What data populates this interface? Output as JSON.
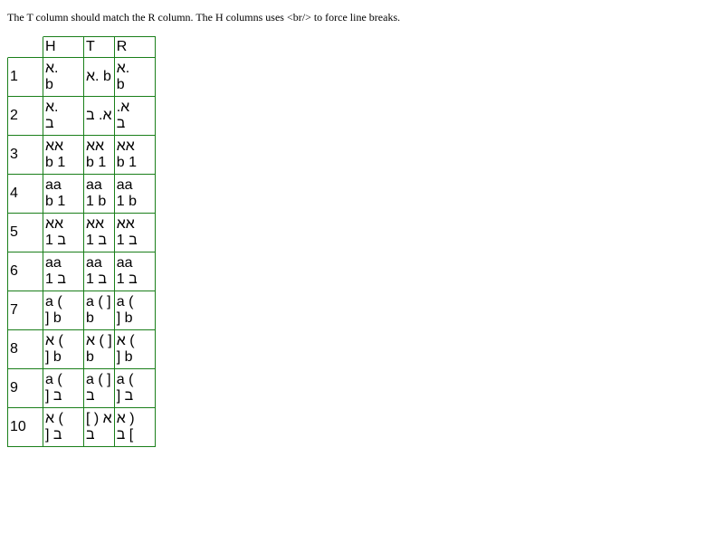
{
  "intro": "The T column should match the R column. The H columns uses <br/> to force line breaks.",
  "headers": {
    "blank": "",
    "h": "H",
    "t": "T",
    "r": "R"
  },
  "rows": [
    {
      "n": "1",
      "h": [
        "א.",
        "b"
      ],
      "t": [
        "א. b"
      ],
      "r": [
        "א.",
        "b"
      ]
    },
    {
      "n": "2",
      "h": [
        "א.",
        "ב"
      ],
      "t": [
        "א. ב"
      ],
      "r": [
        ".א",
        "ב"
      ]
    },
    {
      "n": "3",
      "h": [
        "אא",
        "b 1"
      ],
      "t": [
        "אא",
        "b 1"
      ],
      "r": [
        "אא",
        "b 1"
      ]
    },
    {
      "n": "4",
      "h": [
        "aa",
        "b 1"
      ],
      "t": [
        "aa",
        "1 b"
      ],
      "r": [
        "aa",
        "1 b"
      ]
    },
    {
      "n": "5",
      "h": [
        "אא",
        "ב 1"
      ],
      "t": [
        "אא",
        "ב 1"
      ],
      "r": [
        "אא",
        "ב 1"
      ]
    },
    {
      "n": "6",
      "h": [
        "aa",
        "ב 1"
      ],
      "t": [
        "aa",
        "ב 1"
      ],
      "r": [
        "aa",
        "ב 1"
      ]
    },
    {
      "n": "7",
      "h": [
        "a (",
        "] b"
      ],
      "t": [
        "a ( ]",
        "b"
      ],
      "r": [
        "a (",
        "] b"
      ]
    },
    {
      "n": "8",
      "h": [
        "א (",
        "] b"
      ],
      "t": [
        "א ( ]",
        "b"
      ],
      "r": [
        "א (",
        "] b"
      ]
    },
    {
      "n": "9",
      "h": [
        "a (",
        "] ב"
      ],
      "t": [
        "a ( ]",
        "ב"
      ],
      "r": [
        "a (",
        "] ב"
      ]
    },
    {
      "n": "10",
      "h": [
        "א (",
        "] ב"
      ],
      "t": [
        "[ ) א",
        "ב"
      ],
      "r": [
        "א )",
        "ב ["
      ]
    }
  ]
}
